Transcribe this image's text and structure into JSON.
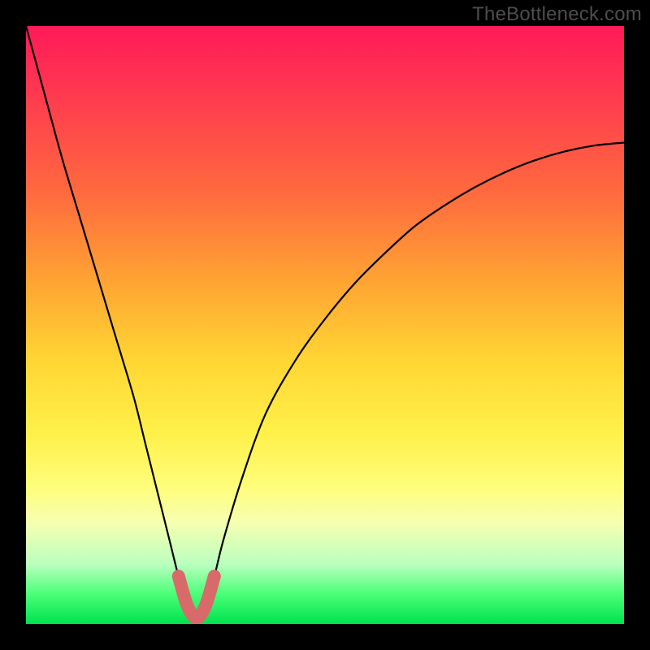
{
  "watermark": "TheBottleneck.com",
  "chart_data": {
    "type": "line",
    "title": "",
    "xlabel": "",
    "ylabel": "",
    "xlim": [
      0,
      100
    ],
    "ylim": [
      0,
      100
    ],
    "grid": false,
    "series": [
      {
        "name": "bottleneck-curve",
        "x": [
          0,
          3,
          6,
          9,
          12,
          15,
          18,
          20,
          22,
          24,
          25.5,
          27,
          28.5,
          30,
          31.5,
          33,
          36,
          40,
          45,
          50,
          55,
          60,
          65,
          70,
          75,
          80,
          85,
          90,
          95,
          100
        ],
        "values": [
          100,
          89,
          78,
          68,
          58,
          48,
          38,
          30,
          22,
          14,
          8,
          3,
          1,
          3,
          8,
          14,
          24,
          35,
          44,
          51,
          57,
          62,
          66.5,
          70,
          73,
          75.5,
          77.5,
          79,
          80,
          80.5
        ]
      }
    ],
    "valley_marker": {
      "x_range": [
        24.5,
        32.5
      ],
      "y_upper": 11
    },
    "curve_color": "#000000",
    "marker_color": "#d86a6a"
  }
}
